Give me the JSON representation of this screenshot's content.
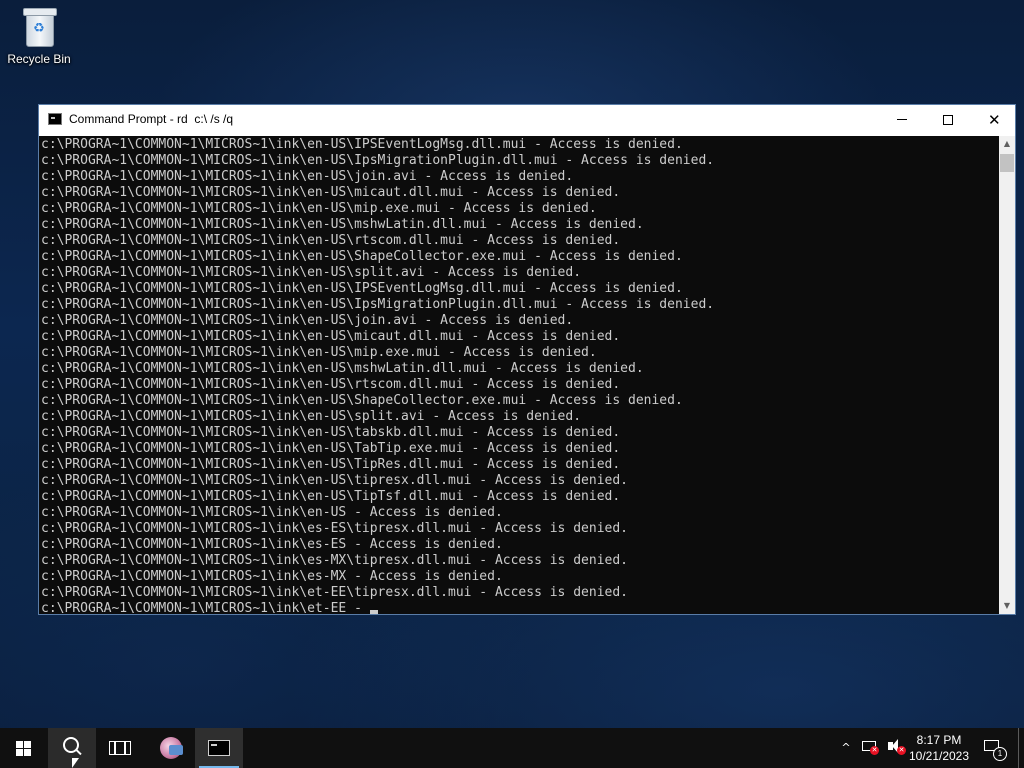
{
  "desktop": {
    "icons": [
      {
        "label": "Recycle Bin",
        "icon": "recycle-bin-icon"
      }
    ]
  },
  "window": {
    "title": "Command Prompt - rd  c:\\ /s /q",
    "controls": {
      "minimize": "minimize-icon",
      "maximize": "maximize-icon",
      "close": "close-icon"
    },
    "close_glyph": "✕"
  },
  "console": {
    "foreground": "#cccccc",
    "background": "#0c0c0c",
    "lines": [
      "c:\\PROGRA~1\\COMMON~1\\MICROS~1\\ink\\en-US\\IPSEventLogMsg.dll.mui - Access is denied.",
      "c:\\PROGRA~1\\COMMON~1\\MICROS~1\\ink\\en-US\\IpsMigrationPlugin.dll.mui - Access is denied.",
      "c:\\PROGRA~1\\COMMON~1\\MICROS~1\\ink\\en-US\\join.avi - Access is denied.",
      "c:\\PROGRA~1\\COMMON~1\\MICROS~1\\ink\\en-US\\micaut.dll.mui - Access is denied.",
      "c:\\PROGRA~1\\COMMON~1\\MICROS~1\\ink\\en-US\\mip.exe.mui - Access is denied.",
      "c:\\PROGRA~1\\COMMON~1\\MICROS~1\\ink\\en-US\\mshwLatin.dll.mui - Access is denied.",
      "c:\\PROGRA~1\\COMMON~1\\MICROS~1\\ink\\en-US\\rtscom.dll.mui - Access is denied.",
      "c:\\PROGRA~1\\COMMON~1\\MICROS~1\\ink\\en-US\\ShapeCollector.exe.mui - Access is denied.",
      "c:\\PROGRA~1\\COMMON~1\\MICROS~1\\ink\\en-US\\split.avi - Access is denied.",
      "c:\\PROGRA~1\\COMMON~1\\MICROS~1\\ink\\en-US\\IPSEventLogMsg.dll.mui - Access is denied.",
      "c:\\PROGRA~1\\COMMON~1\\MICROS~1\\ink\\en-US\\IpsMigrationPlugin.dll.mui - Access is denied.",
      "c:\\PROGRA~1\\COMMON~1\\MICROS~1\\ink\\en-US\\join.avi - Access is denied.",
      "c:\\PROGRA~1\\COMMON~1\\MICROS~1\\ink\\en-US\\micaut.dll.mui - Access is denied.",
      "c:\\PROGRA~1\\COMMON~1\\MICROS~1\\ink\\en-US\\mip.exe.mui - Access is denied.",
      "c:\\PROGRA~1\\COMMON~1\\MICROS~1\\ink\\en-US\\mshwLatin.dll.mui - Access is denied.",
      "c:\\PROGRA~1\\COMMON~1\\MICROS~1\\ink\\en-US\\rtscom.dll.mui - Access is denied.",
      "c:\\PROGRA~1\\COMMON~1\\MICROS~1\\ink\\en-US\\ShapeCollector.exe.mui - Access is denied.",
      "c:\\PROGRA~1\\COMMON~1\\MICROS~1\\ink\\en-US\\split.avi - Access is denied.",
      "c:\\PROGRA~1\\COMMON~1\\MICROS~1\\ink\\en-US\\tabskb.dll.mui - Access is denied.",
      "c:\\PROGRA~1\\COMMON~1\\MICROS~1\\ink\\en-US\\TabTip.exe.mui - Access is denied.",
      "c:\\PROGRA~1\\COMMON~1\\MICROS~1\\ink\\en-US\\TipRes.dll.mui - Access is denied.",
      "c:\\PROGRA~1\\COMMON~1\\MICROS~1\\ink\\en-US\\tipresx.dll.mui - Access is denied.",
      "c:\\PROGRA~1\\COMMON~1\\MICROS~1\\ink\\en-US\\TipTsf.dll.mui - Access is denied.",
      "c:\\PROGRA~1\\COMMON~1\\MICROS~1\\ink\\en-US - Access is denied.",
      "c:\\PROGRA~1\\COMMON~1\\MICROS~1\\ink\\es-ES\\tipresx.dll.mui - Access is denied.",
      "c:\\PROGRA~1\\COMMON~1\\MICROS~1\\ink\\es-ES - Access is denied.",
      "c:\\PROGRA~1\\COMMON~1\\MICROS~1\\ink\\es-MX\\tipresx.dll.mui - Access is denied.",
      "c:\\PROGRA~1\\COMMON~1\\MICROS~1\\ink\\es-MX - Access is denied.",
      "c:\\PROGRA~1\\COMMON~1\\MICROS~1\\ink\\et-EE\\tipresx.dll.mui - Access is denied."
    ],
    "current_line": "c:\\PROGRA~1\\COMMON~1\\MICROS~1\\ink\\et-EE - "
  },
  "scrollbar": {
    "up_glyph": "▲",
    "down_glyph": "▼"
  },
  "taskbar": {
    "items": [
      {
        "name": "start",
        "icon": "windows-logo-icon"
      },
      {
        "name": "search",
        "icon": "search-icon"
      },
      {
        "name": "task-view",
        "icon": "task-view-icon"
      },
      {
        "name": "pinned-app",
        "icon": "paint-app-icon"
      },
      {
        "name": "command-prompt",
        "icon": "command-prompt-icon",
        "active": true
      }
    ],
    "accent": "#76b9ed",
    "tray": {
      "chevron": "^",
      "network_status": "disconnected",
      "volume_status": "muted",
      "time": "8:17 PM",
      "date": "10/21/2023",
      "notification_count": "1"
    }
  }
}
